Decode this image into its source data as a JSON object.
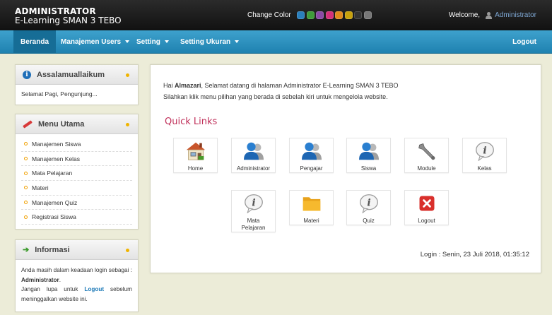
{
  "header": {
    "brand_line1": "ADMINISTRATOR",
    "brand_line2": "E-Learning SMAN 3 TEBO",
    "change_color_label": "Change Color",
    "swatches": [
      "#2a7fbd",
      "#3f9b3a",
      "#8b4aa6",
      "#d4307a",
      "#e08a1c",
      "#c8a10c",
      "#333333",
      "#777777"
    ],
    "welcome_label": "Welcome,",
    "user_name": "Administrator"
  },
  "nav": {
    "items": [
      {
        "label": "Beranda"
      },
      {
        "label": "Manajemen Users"
      },
      {
        "label": "Setting"
      },
      {
        "label": "Setting Ukuran"
      }
    ],
    "logout": "Logout"
  },
  "sidebar": {
    "greeting_box": {
      "title": "Assalamuallaikum",
      "text": "Selamat Pagi, Pengunjung..."
    },
    "menu_box": {
      "title": "Menu Utama",
      "items": [
        "Manajemen Siswa",
        "Manajemen Kelas",
        "Mata Pelajaran",
        "Materi",
        "Manajemen Quiz",
        "Registrasi Siswa"
      ]
    },
    "info_box": {
      "title": "Informasi",
      "text_1": "Anda masih dalam keadaan login sebagai : ",
      "role": "Administrator",
      "text_2": "Jangan lupa untuk ",
      "logout_link": "Logout",
      "text_3": " sebelum meninggalkan website ini."
    }
  },
  "main": {
    "greet_prefix": "Hai ",
    "greet_name": "Almazari",
    "greet_suffix": ", Selamat datang di halaman Administrator E-Learning SMAN 3 TEBO",
    "greet_line2": "Silahkan klik menu pilihan yang berada di sebelah kiri untuk mengelola website.",
    "quick_links_title": "Quick Links",
    "tiles": [
      {
        "label": "Home",
        "icon": "home-icon"
      },
      {
        "label": "Administrator",
        "icon": "user-icon"
      },
      {
        "label": "Pengajar",
        "icon": "user-icon"
      },
      {
        "label": "Siswa",
        "icon": "user-icon"
      },
      {
        "label": "Module",
        "icon": "wrench-icon"
      },
      {
        "label": "Kelas",
        "icon": "info-bubble-icon"
      },
      {
        "label": "Mata Pelajaran",
        "icon": "info-bubble-icon"
      },
      {
        "label": "Materi",
        "icon": "folder-icon"
      },
      {
        "label": "Quiz",
        "icon": "info-bubble-icon"
      },
      {
        "label": "Logout",
        "icon": "close-icon"
      }
    ],
    "login_info": "Login : Senin, 23 Juli 2018, 01:35:12"
  }
}
